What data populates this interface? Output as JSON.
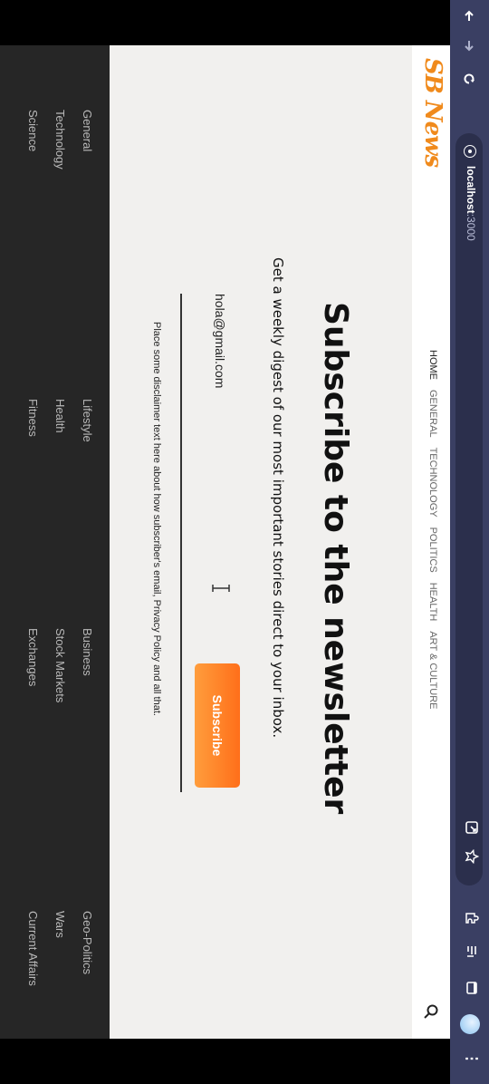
{
  "browser": {
    "url_host": "localhost",
    "url_port": ":3000",
    "icons": [
      "back-arrow-icon",
      "forward-arrow-icon",
      "reload-icon",
      "info-icon",
      "open-in-app-icon",
      "star-icon",
      "extension-icon",
      "reading-list-icon",
      "tab-icon",
      "avatar-icon",
      "menu-icon"
    ]
  },
  "site": {
    "logo": "SB News",
    "nav": [
      "HOME",
      "GENERAL",
      "TECHNOLOGY",
      "POLITICS",
      "HEALTH",
      "ART & CULTURE"
    ]
  },
  "newsletter": {
    "title": "Subscribe to the newsletter",
    "subtitle": "Get a weekly digest of our most important stories direct to your inbox.",
    "email_value": "hola@gmail.com",
    "button_label": "Subscribe",
    "disclaimer": "Place some disclaimer text here about how subscriber's email, Privacy Policy and all that."
  },
  "footer": {
    "columns": [
      [
        "General",
        "Technology",
        "Science"
      ],
      [
        "Lifestyle",
        "Health",
        "Fitness"
      ],
      [
        "Business",
        "Stock Markets",
        "Exchanges"
      ],
      [
        "Geo-Politics",
        "Wars",
        "Current Affairs"
      ]
    ]
  },
  "colors": {
    "accent": "#ff7f27",
    "chrome": "#3a3f63",
    "footer": "#262626",
    "page_bg": "#f1f0ee"
  }
}
